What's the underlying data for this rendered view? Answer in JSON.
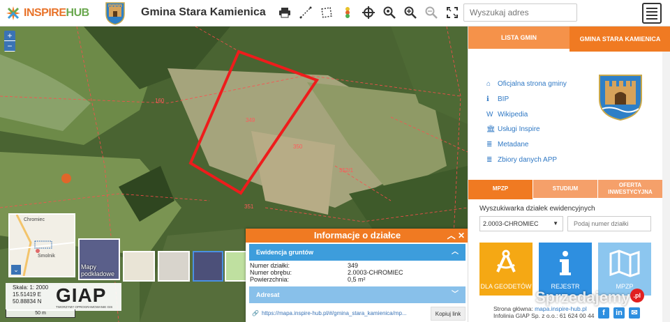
{
  "header": {
    "logo_part1": "INSPIRE",
    "logo_part2": "HUB",
    "gmina_title": "Gmina Stara Kamienica",
    "search_placeholder": "Wyszukaj adres",
    "tools": [
      "print-icon",
      "measure-line-icon",
      "measure-area-icon",
      "color-marker-icon",
      "crosshair-icon",
      "zoom-in-icon",
      "zoom-search-icon",
      "zoom-out-icon",
      "fullscreen-icon"
    ]
  },
  "map": {
    "zoom_in": "+",
    "zoom_out": "−",
    "minimap_labels": [
      "Chromiec",
      "Smolnik"
    ],
    "minimap_toggle": "⌄",
    "basemap_label": "Mapy podkładowe",
    "scale": {
      "ratio": "Skala: 1: 2000",
      "lon": "15.51419 E",
      "lat": "50.88834 N",
      "bar": "50 m"
    },
    "giap": "GIAP",
    "giap_sub": "TWORZYMY OPROGRAMOWANIE GIS",
    "parcel_labels": [
      "160",
      "349",
      "350",
      "352/1",
      "351"
    ]
  },
  "info": {
    "title": "Informacje o działce",
    "section1": "Ewidencja gruntów",
    "rows": [
      {
        "k": "Numer działki:",
        "v": "349"
      },
      {
        "k": "Numer obrębu:",
        "v": "2.0003-CHROMIEC"
      },
      {
        "k": "Powierzchnia:",
        "v": "0,5 m²"
      }
    ],
    "section2": "Adresat",
    "url": "https://mapa.inspire-hub.pl/#/gmina_stara_kamienica/mp...",
    "copy_label": "Kopiuj link"
  },
  "right": {
    "tab_lista": "LISTA GMIN",
    "tab_gmina": "GMINA STARA KAMIENICA",
    "links": [
      {
        "icon": "home-icon",
        "glyph": "⌂",
        "label": "Oficjalna strona gminy"
      },
      {
        "icon": "info-icon",
        "glyph": "ℹ",
        "label": "BIP"
      },
      {
        "icon": "wikipedia-icon",
        "glyph": "W",
        "label": "Wikipedia"
      },
      {
        "icon": "institution-icon",
        "glyph": "🏛",
        "label": "Usługi Inspire"
      },
      {
        "icon": "database-icon",
        "glyph": "≣",
        "label": "Metadane"
      },
      {
        "icon": "database-icon",
        "glyph": "≣",
        "label": "Zbiory danych APP"
      }
    ],
    "mid_tabs": [
      "MPZP",
      "STUDIUM",
      "OFERTA INWESTYCYJNA"
    ],
    "wyszukiwarka": "Wyszukiwarka działek ewidencyjnych",
    "select_value": "2.0003-CHROMIEC",
    "parcel_placeholder": "Podaj numer działki",
    "tiles": [
      "DLA GEODETÓW",
      "REJESTR",
      "MPZP"
    ],
    "footer_line1_label": "Strona główna:",
    "footer_line1_url": "mapa.inspire-hub.pl",
    "footer_line2": "Infolinia GIAP Sp. z o.o.: 61 624 00 44",
    "social": [
      "f",
      "in",
      "✉"
    ],
    "watermark": "Sprzedajemy",
    "watermark_badge": ".pl"
  },
  "colors": {
    "accent": "#f07a22",
    "blue": "#3d9ddc",
    "parcel": "#ee1c1c"
  }
}
